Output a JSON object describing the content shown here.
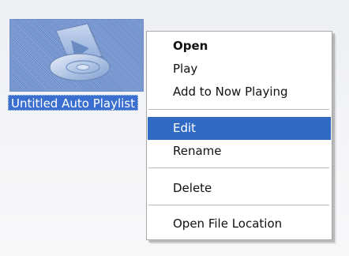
{
  "desktop_item": {
    "label": "Untitled Auto Playlist",
    "icon": "playlist-icon"
  },
  "context_menu": {
    "items": [
      {
        "label": "Open",
        "style": "bold"
      },
      {
        "label": "Play"
      },
      {
        "label": "Add to Now Playing"
      },
      {
        "label": "Edit",
        "state": "highlighted"
      },
      {
        "label": "Rename"
      },
      {
        "label": "Delete"
      },
      {
        "label": "Open File Location"
      }
    ]
  },
  "colors": {
    "selection": "#316ac5",
    "label_selection": "#3a6fd0",
    "menu_background": "#ffffff",
    "separator": "#b9b9b9"
  }
}
